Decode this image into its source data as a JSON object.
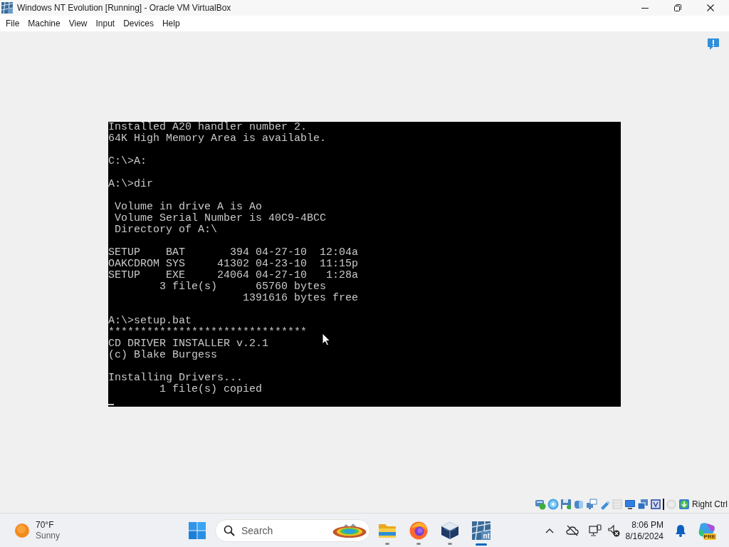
{
  "window": {
    "title": "Windows NT Evolution [Running] - Oracle VM VirtualBox"
  },
  "menu": [
    "File",
    "Machine",
    "View",
    "Input",
    "Devices",
    "Help"
  ],
  "console": {
    "blocks": [
      [
        "Installed A20 handler number 2.",
        "64K High Memory Area is available."
      ],
      [
        "C:\\>A:"
      ],
      [
        "A:\\>dir"
      ],
      [
        " Volume in drive A is Ao",
        " Volume Serial Number is 40C9-4BCC",
        " Directory of A:\\"
      ],
      [
        "SETUP    BAT       394 04-27-10  12:04a",
        "OAKCDROM SYS     41302 04-23-10  11:15p",
        "SETUP    EXE     24064 04-27-10   1:28a",
        "        3 file(s)      65760 bytes",
        "                     1391616 bytes free"
      ],
      [
        "A:\\>setup.bat",
        "*******************************",
        "CD DRIVER INSTALLER v.2.1",
        "(c) Blake Burgess"
      ],
      [
        "Installing Drivers...",
        "        1 file(s) copied"
      ]
    ]
  },
  "status_bar": {
    "host_key": "Right Ctrl"
  },
  "taskbar": {
    "weather": {
      "temperature": "70°F",
      "condition": "Sunny"
    },
    "search": {
      "placeholder": "Search"
    },
    "apps": [
      {
        "kind": "folder",
        "selected": false
      },
      {
        "kind": "browser",
        "selected": false
      },
      {
        "kind": "cube",
        "selected": false
      },
      {
        "kind": "nt",
        "selected": true,
        "label": "nt"
      }
    ],
    "clock": {
      "time": "8:06 PM",
      "date": "8/16/2024"
    },
    "assistant_badge": "PRE"
  }
}
